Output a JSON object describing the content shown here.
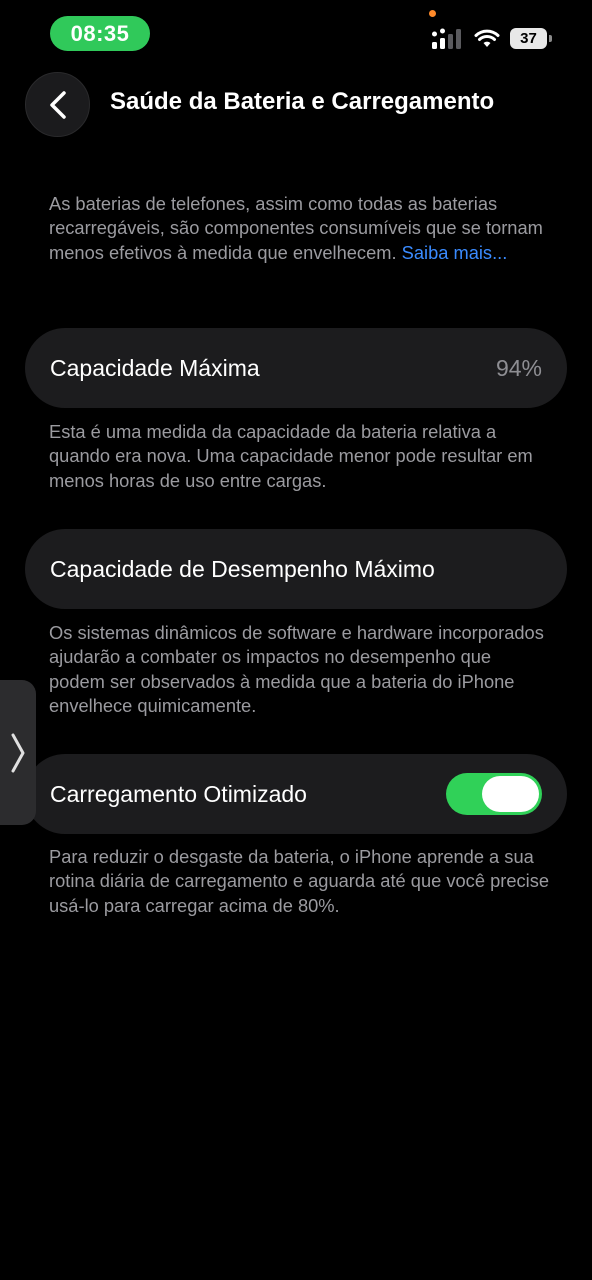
{
  "status_bar": {
    "time": "08:35",
    "battery_level": "37",
    "icons": [
      "signal-icon",
      "wifi-icon",
      "battery-icon"
    ]
  },
  "header": {
    "back_icon": "chevron-left-icon",
    "title": "Saúde da Bateria e Carregamento"
  },
  "intro": {
    "text": "As baterias de telefones, assim como todas as baterias recarregáveis, são componentes consumíveis que se tornam menos efetivos à medida que envelhecem. ",
    "link": "Saiba mais..."
  },
  "max_capacity": {
    "label": "Capacidade Máxima",
    "value": "94%",
    "description": "Esta é uma medida da capacidade da bateria relativa a quando era nova. Uma capacidade menor pode resultar em menos horas de uso entre cargas."
  },
  "peak_performance": {
    "label": "Capacidade de Desempenho Máximo",
    "description": "Os sistemas dinâmicos de software e hardware incorporados ajudarão a combater os impactos no desempenho que podem ser observados à medida que a bateria do iPhone envelhece quimicamente."
  },
  "optimized_charging": {
    "label": "Carregamento Otimizado",
    "enabled": true,
    "description": "Para reduzir o desgaste da bateria, o iPhone aprende a sua rotina diária de carregamento e aguarda até que você precise usá-lo para carregar acima de 80%."
  },
  "colors": {
    "background": "#000000",
    "card": "#1c1c1e",
    "accent_green": "#30d158",
    "link_blue": "#3a8bff",
    "secondary_text": "#9b9ba0"
  },
  "side_tab_icon": "chevron-right-icon"
}
